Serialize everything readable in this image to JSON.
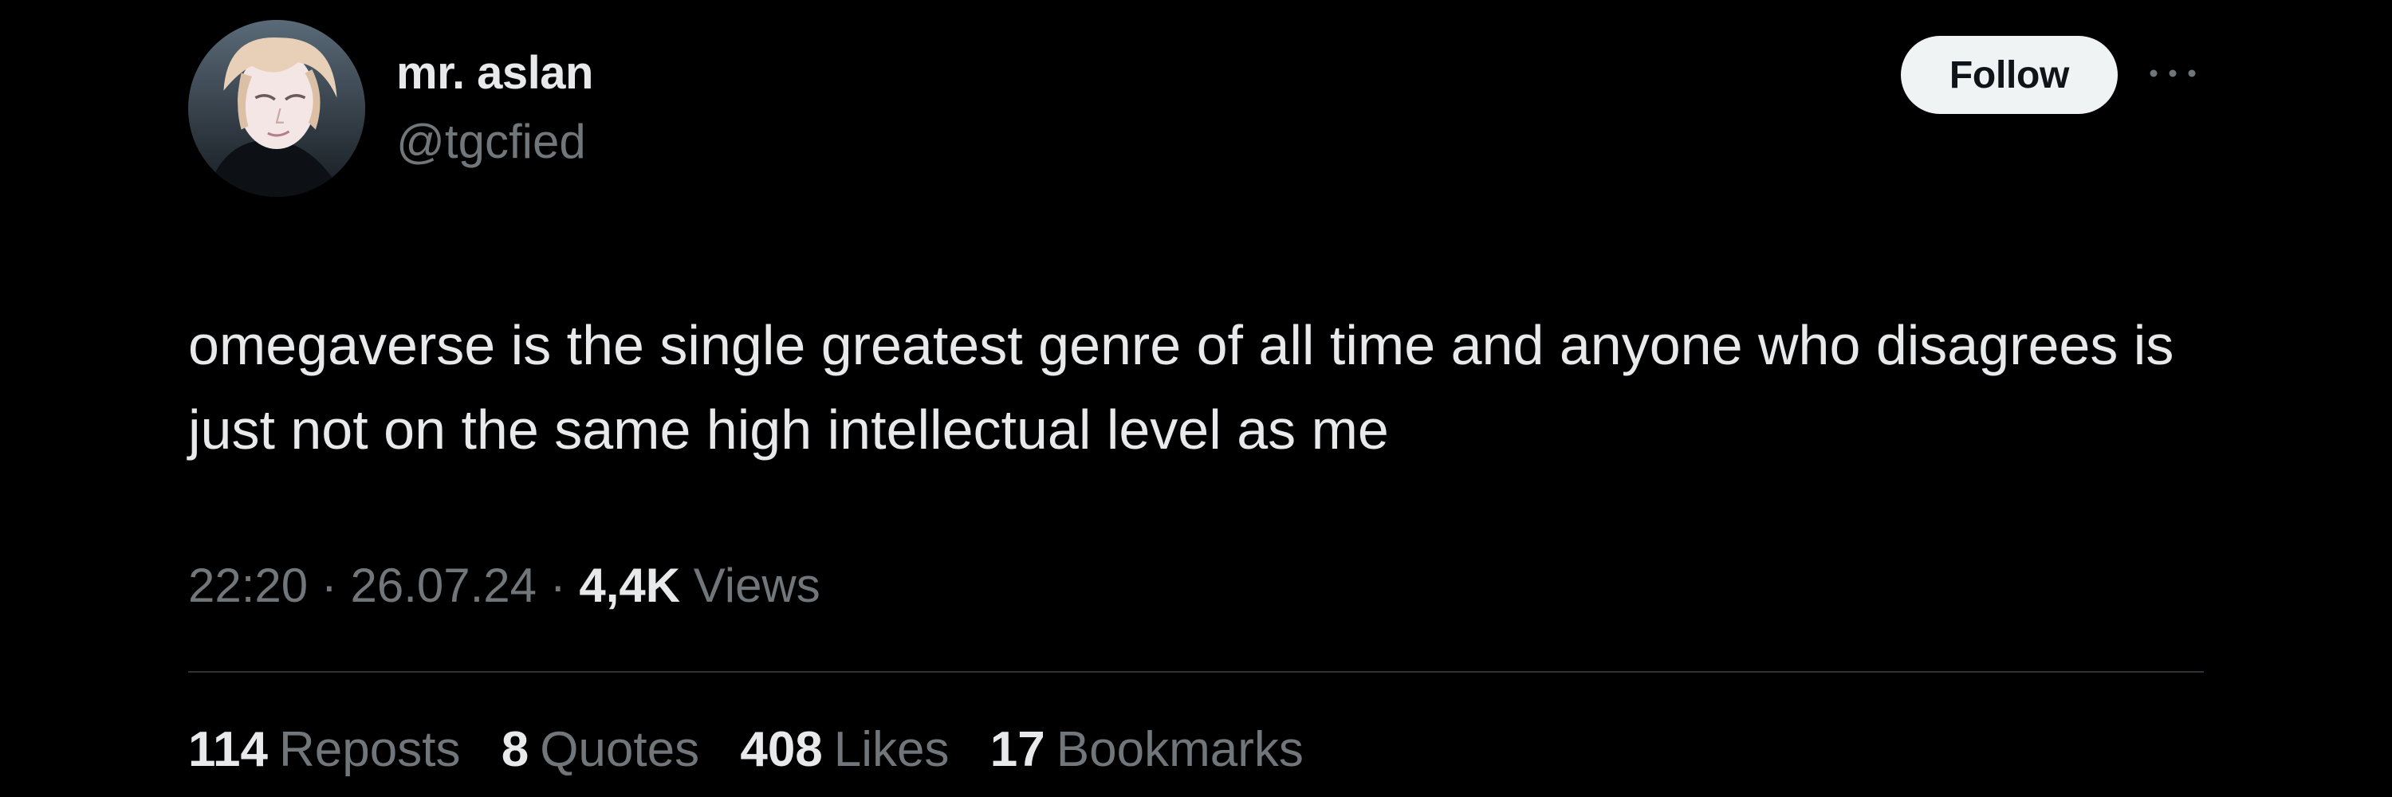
{
  "author": {
    "display_name": "mr. aslan",
    "handle": "@tgcfied"
  },
  "follow_label": "Follow",
  "more_icon": "more-horizontal-icon",
  "tweet_text": "omegaverse is the single greatest genre of all time and anyone who disagrees is just not on the same high intellectual level as me",
  "meta": {
    "time": "22:20",
    "separator": "·",
    "date": "26.07.24",
    "views_count": "4,4K",
    "views_label": "Views"
  },
  "stats": {
    "reposts": {
      "count": "114",
      "label": "Reposts"
    },
    "quotes": {
      "count": "8",
      "label": "Quotes"
    },
    "likes": {
      "count": "408",
      "label": "Likes"
    },
    "bookmarks": {
      "count": "17",
      "label": "Bookmarks"
    }
  },
  "colors": {
    "background": "#000000",
    "primary_text": "#e7e9ea",
    "secondary_text": "#71767b",
    "button_bg": "#eff3f4",
    "divider": "#2f3336"
  }
}
